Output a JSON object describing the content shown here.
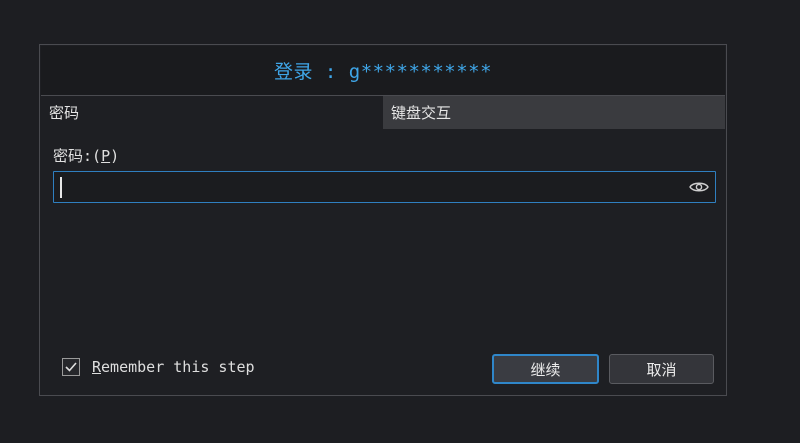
{
  "dialog": {
    "title": "登录 : g***********",
    "tabs": [
      {
        "label": "密码",
        "active": true
      },
      {
        "label": "键盘交互",
        "active": false
      }
    ],
    "password_field": {
      "label_prefix": "密码:(",
      "mnemonic": "P",
      "label_suffix": ")",
      "value": "",
      "reveal_icon": "eye-icon"
    },
    "remember": {
      "checked": true,
      "mnemonic": "R",
      "label_rest": "emember this step"
    },
    "buttons": {
      "continue": "继续",
      "cancel": "取消"
    }
  },
  "colors": {
    "accent": "#3fa6e8",
    "focus_border": "#2f7fc0",
    "background": "#1d1e22",
    "tab_inactive": "#3a3b3f"
  }
}
